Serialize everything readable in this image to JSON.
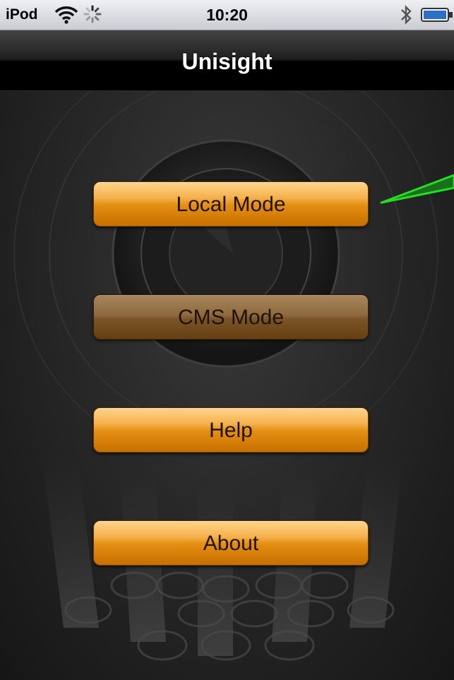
{
  "status_bar": {
    "carrier": "iPod",
    "time": "10:20"
  },
  "nav": {
    "title": "Unisight"
  },
  "menu": {
    "local_mode": "Local Mode",
    "cms_mode": "CMS Mode",
    "help": "Help",
    "about": "About"
  },
  "colors": {
    "button_orange": "#e48f12",
    "button_disabled": "#7a5428",
    "annotation_green": "#22dd22"
  },
  "icons": [
    "wifi-icon",
    "activity-spinner-icon",
    "bluetooth-icon",
    "battery-icon"
  ]
}
